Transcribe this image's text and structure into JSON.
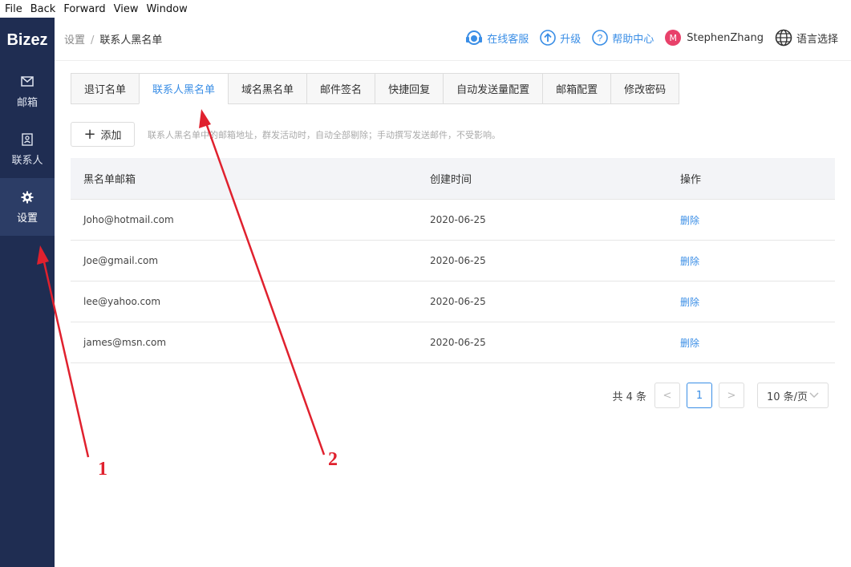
{
  "menubar": [
    "File",
    "Back",
    "Forward",
    "View",
    "Window"
  ],
  "sidebar": {
    "logo": "Bizez",
    "items": [
      {
        "label": "邮箱",
        "icon": "mail-icon"
      },
      {
        "label": "联系人",
        "icon": "contact-card-icon"
      },
      {
        "label": "设置",
        "icon": "gear-icon",
        "active": true
      }
    ]
  },
  "breadcrumb": {
    "root": "设置",
    "sep": "/",
    "current": "联系人黑名单"
  },
  "header": {
    "support": "在线客服",
    "upgrade": "升级",
    "help": "帮助中心",
    "avatar_letter": "M",
    "username": "StephenZhang",
    "language": "语言选择"
  },
  "tabs": [
    "退订名单",
    "联系人黑名单",
    "域名黑名单",
    "邮件签名",
    "快捷回复",
    "自动发送量配置",
    "邮箱配置",
    "修改密码"
  ],
  "active_tab": 1,
  "toolbar": {
    "add_label": "添加",
    "hint": "联系人黑名单中的邮箱地址，群发活动时，自动全部剔除；手动撰写发送邮件，不受影响。"
  },
  "table": {
    "columns": [
      "黑名单邮箱",
      "创建时间",
      "操作"
    ],
    "rows": [
      {
        "email": "Joho@hotmail.com",
        "created": "2020-06-25",
        "action": "删除"
      },
      {
        "email": "Joe@gmail.com",
        "created": "2020-06-25",
        "action": "删除"
      },
      {
        "email": "lee@yahoo.com",
        "created": "2020-06-25",
        "action": "删除"
      },
      {
        "email": "james@msn.com",
        "created": "2020-06-25",
        "action": "删除"
      }
    ]
  },
  "pagination": {
    "total": "共 4 条",
    "prev": "<",
    "current": "1",
    "next": ">",
    "page_size": "10 条/页"
  },
  "annotations": {
    "one": "1",
    "two": "2",
    "color": "#e0212e"
  }
}
